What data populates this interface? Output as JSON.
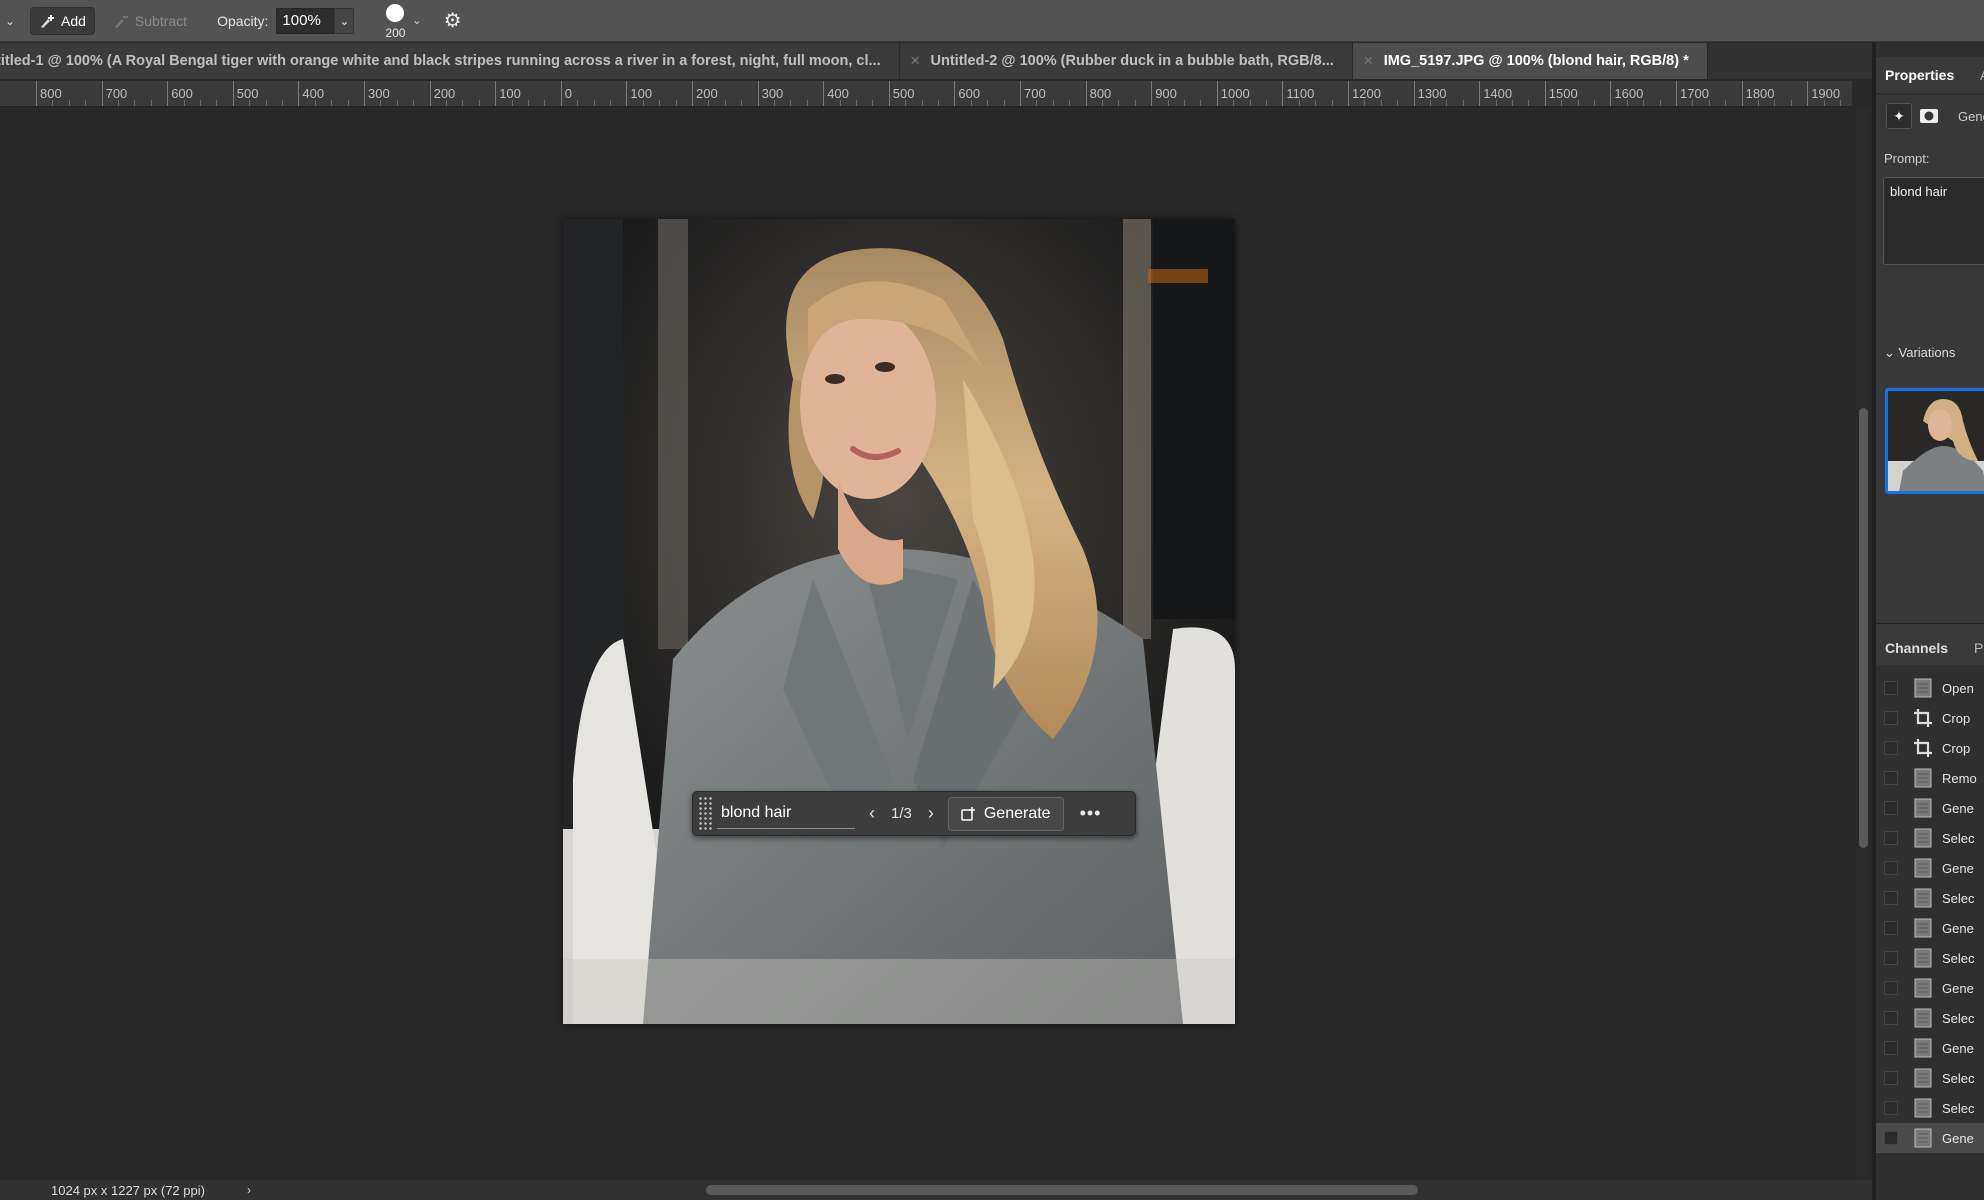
{
  "options_bar": {
    "add_label": "Add",
    "subtract_label": "Subtract",
    "opacity_label": "Opacity:",
    "opacity_value": "100%",
    "brush_size": "200"
  },
  "tabs": [
    {
      "label": "ıtitled-1 @ 100% (A Royal Bengal tiger with orange white and black stripes running across a river in a forest, night, full moon, cl...",
      "active": false
    },
    {
      "label": "Untitled-2 @ 100% (Rubber duck in a bubble bath, RGB/8...",
      "active": false
    },
    {
      "label": "IMG_5197.JPG @ 100% (blond hair, RGB/8) *",
      "active": true
    }
  ],
  "ruler": [
    "800",
    "700",
    "600",
    "500",
    "400",
    "300",
    "200",
    "100",
    "0",
    "100",
    "200",
    "300",
    "400",
    "500",
    "600",
    "700",
    "800",
    "900",
    "1000",
    "1100",
    "1200",
    "1300",
    "1400",
    "1500",
    "1600",
    "1700",
    "1800",
    "1900"
  ],
  "task_bar": {
    "prompt": "blond hair",
    "counter": "1/3",
    "generate_label": "Generate"
  },
  "status_bar": {
    "doc_info": "1024 px x 1227 px (72 ppi)"
  },
  "properties": {
    "tab": "Properties",
    "generate_label": "Gene",
    "prompt_label": "Prompt:",
    "prompt_value": "blond hair",
    "variations_label": "Variations"
  },
  "channels": {
    "tab": "Channels",
    "tab2": "Pa"
  },
  "history": [
    {
      "name": "Open",
      "icon": "document-icon"
    },
    {
      "name": "Crop",
      "icon": "crop-icon"
    },
    {
      "name": "Crop",
      "icon": "crop-icon"
    },
    {
      "name": "Remo",
      "icon": "document-icon"
    },
    {
      "name": "Gene",
      "icon": "document-icon"
    },
    {
      "name": "Selec",
      "icon": "document-icon"
    },
    {
      "name": "Gene",
      "icon": "document-icon"
    },
    {
      "name": "Selec",
      "icon": "document-icon"
    },
    {
      "name": "Gene",
      "icon": "document-icon"
    },
    {
      "name": "Selec",
      "icon": "document-icon"
    },
    {
      "name": "Gene",
      "icon": "document-icon"
    },
    {
      "name": "Selec",
      "icon": "document-icon"
    },
    {
      "name": "Gene",
      "icon": "document-icon"
    },
    {
      "name": "Selec",
      "icon": "document-icon"
    },
    {
      "name": "Selec",
      "icon": "document-icon"
    },
    {
      "name": "Gene",
      "icon": "document-icon",
      "selected": true
    }
  ],
  "colors": {
    "accent": "#1473e6",
    "canvas": "#282828",
    "panel": "#383838"
  }
}
